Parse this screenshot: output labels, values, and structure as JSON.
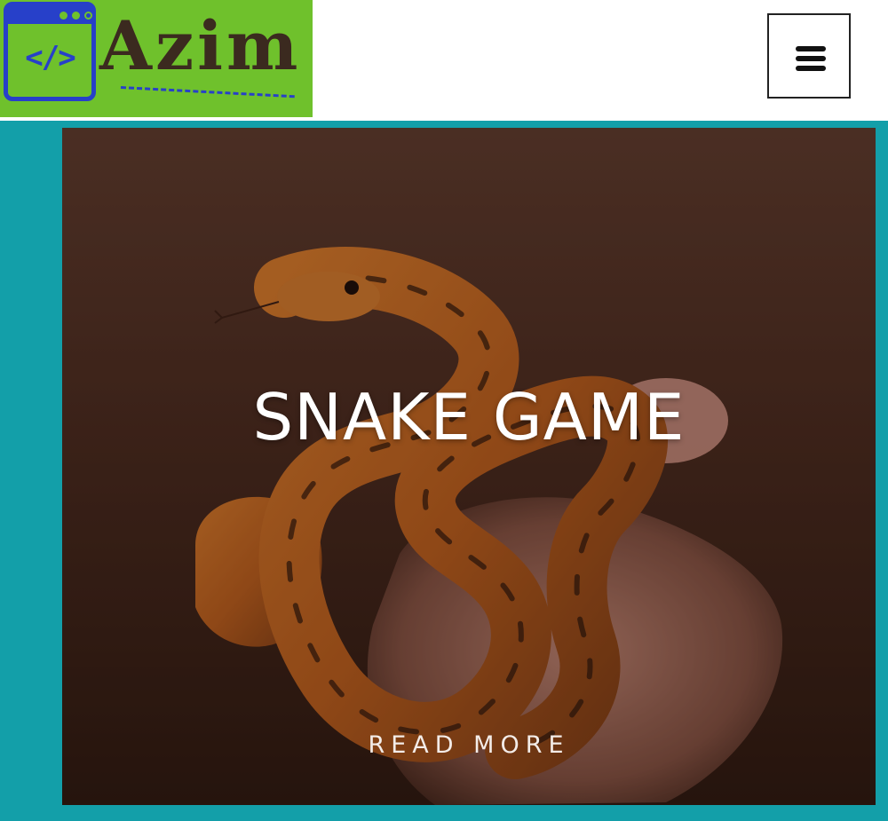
{
  "header": {
    "logo": {
      "code_glyph": "</>",
      "text": "Azim",
      "background_color": "#6fc12c",
      "accent_color": "#2740c9",
      "text_color": "#3b2a1f"
    },
    "menu_button": {
      "icon": "hamburger-menu-icon"
    }
  },
  "stage": {
    "background_color": "#139fa9"
  },
  "card": {
    "title": "SNAKE GAME",
    "link_label": "READ MORE",
    "image": "snake-on-hand-photo"
  }
}
